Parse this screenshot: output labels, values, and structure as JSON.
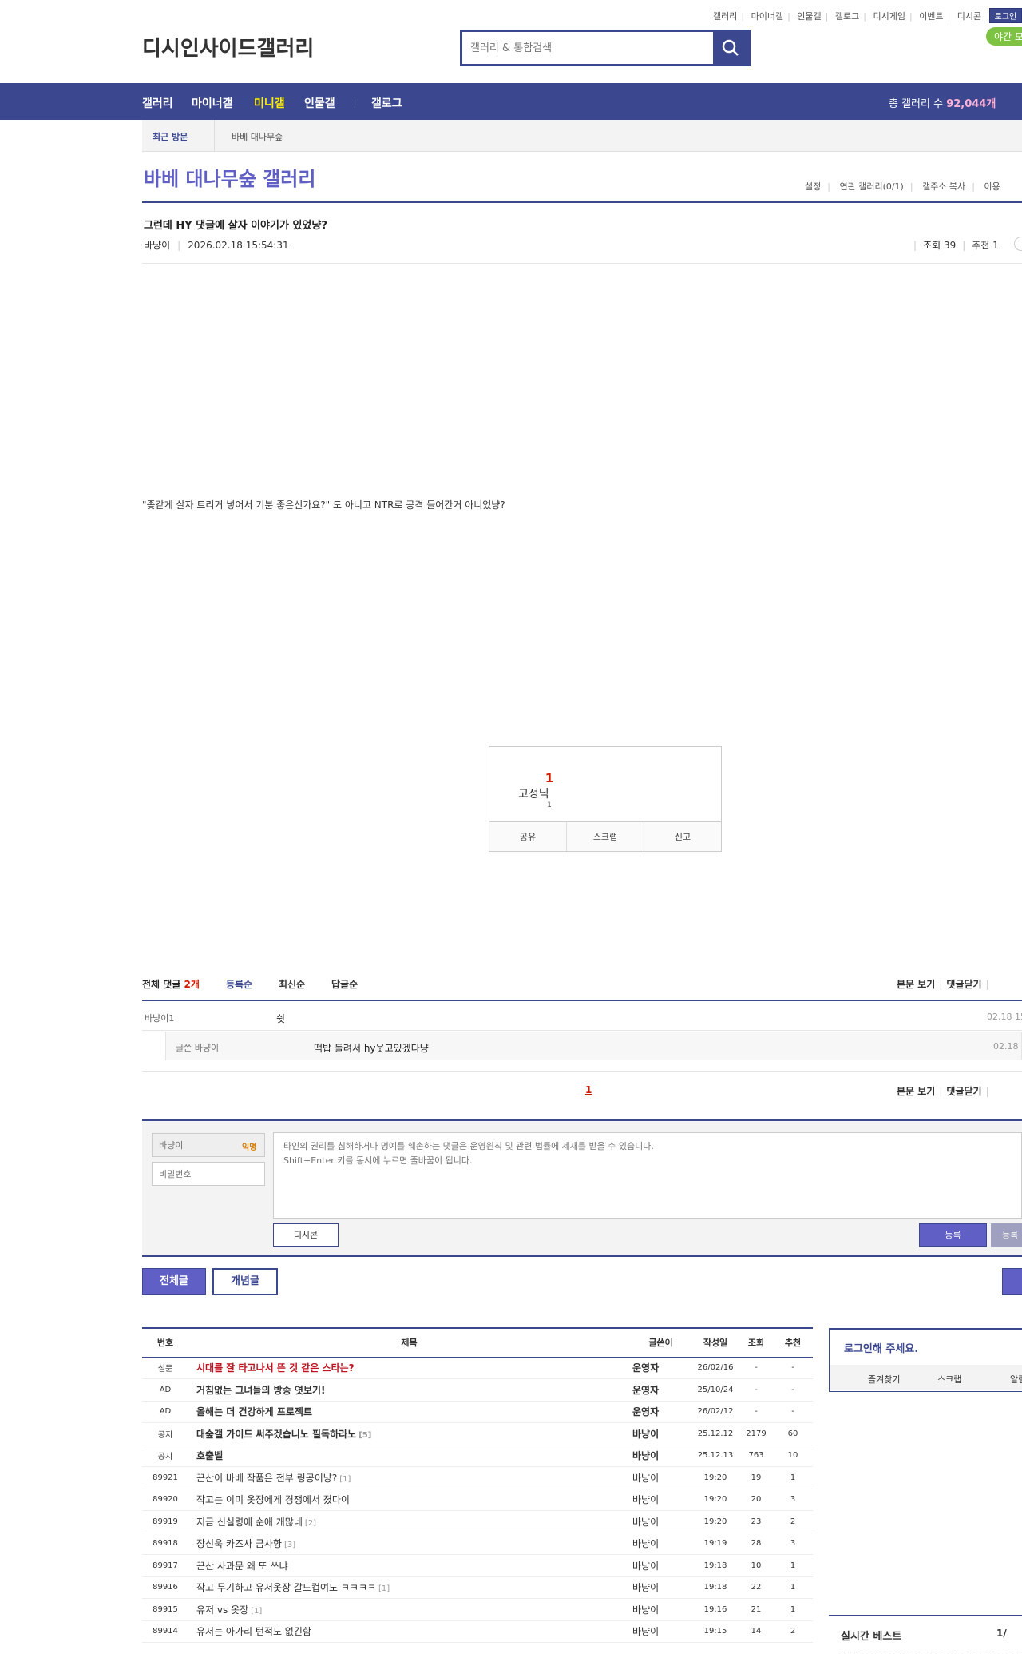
{
  "topbar": {
    "links": [
      "갤러리",
      "마이너갤",
      "인물갤",
      "갤로그",
      "디시게임",
      "이벤트",
      "디시콘"
    ],
    "login": "로그인"
  },
  "header": {
    "logo_alt": "디시인사이드갤러리",
    "search_placeholder": "갤러리 & 통합검색",
    "night_mode": "야간 모"
  },
  "gnb": {
    "items": [
      "갤러리",
      "마이너갤",
      "미니갤",
      "인물갤",
      "갤로그"
    ],
    "active_index": 2,
    "total_label": "총 갤러리 수",
    "total_count": "92,044개"
  },
  "recent": {
    "title": "최근 방문",
    "gallery": "바베 대나무숲"
  },
  "gallery": {
    "title": "바베 대나무숲 갤러리",
    "options": [
      "설정",
      "연관 갤러리(0/1)",
      "갤주소 복사",
      "이용"
    ]
  },
  "post": {
    "title": "그런데 HY 댓글에 살자 이야기가 있었냥?",
    "author": "바냥이",
    "date": "2026.02.18 15:54:31",
    "views": "조회 39",
    "recommends": "추천 1",
    "body": "\"좆같게 살자 트리거 넣어서 기분 좋은신가요?\" 도 아니고 NTR로 공격 들어간거 아니었냥?"
  },
  "recommend_box": {
    "count": "1",
    "fixed_alt": "고정닉",
    "fixed_count": "1",
    "buttons": [
      "공유",
      "스크랩",
      "신고"
    ]
  },
  "comments": {
    "total_label": "전체 댓글",
    "total_count": "2개",
    "sorts": [
      "등록순",
      "최신순",
      "답글순"
    ],
    "view_post": "본문 보기",
    "close": "댓글닫기",
    "items": [
      {
        "nick": "바냥이1",
        "text": "쉿",
        "date": "02.18 15"
      }
    ],
    "replies": [
      {
        "nick": "글쓴 바냥이",
        "text": "떡밥 돌려서 hy웃고있겠다냥",
        "date": "02.18 1"
      }
    ],
    "page": "1"
  },
  "write": {
    "nick_placeholder": "바냥이",
    "anon": "익명",
    "pw_placeholder": "비밀번호",
    "textarea_placeholder": "타인의 권리를 침해하거나 명예를 훼손하는 댓글은 운영원칙 및 관련 법률에 제재를 받을 수 있습니다.\nShift+Enter 키를 동시에 누르면 줄바꿈이 됩니다.",
    "dccon": "디시콘",
    "submit": "등록",
    "submit2": "등록"
  },
  "tabs": {
    "all": "전체글",
    "best": "개념글"
  },
  "board": {
    "headers": [
      "번호",
      "제목",
      "글쓴이",
      "작성일",
      "조회",
      "추천"
    ],
    "rows": [
      {
        "no": "설문",
        "title": "시대를 잘 타고나서 뜬 것 같은 스타는?",
        "replies": "",
        "writer": "운영자",
        "date": "26/02/16",
        "views": "-",
        "rec": "-",
        "type": "survey"
      },
      {
        "no": "AD",
        "title": "거침없는 그녀들의 방송 엿보기!",
        "replies": "",
        "writer": "운영자",
        "date": "25/10/24",
        "views": "-",
        "rec": "-",
        "type": "notice"
      },
      {
        "no": "AD",
        "title": "올해는 더 건강하게 프로젝트",
        "replies": "",
        "writer": "운영자",
        "date": "26/02/12",
        "views": "-",
        "rec": "-",
        "type": "notice"
      },
      {
        "no": "공지",
        "title": "대숲갤 가이드 써주겠습니노 필독하라노",
        "replies": "[5]",
        "writer": "바냥이",
        "date": "25.12.12",
        "views": "2179",
        "rec": "60",
        "type": "notice"
      },
      {
        "no": "공지",
        "title": "호출벨",
        "replies": "",
        "writer": "바냥이",
        "date": "25.12.13",
        "views": "763",
        "rec": "10",
        "type": "notice"
      },
      {
        "no": "89921",
        "title": "끈산이 바베 작품은 전부 링공이냥?",
        "replies": "[1]",
        "writer": "바냥이",
        "date": "19:20",
        "views": "19",
        "rec": "1",
        "type": "normal"
      },
      {
        "no": "89920",
        "title": "작고는 이미 옷장에게 경쟁에서 졌다이",
        "replies": "",
        "writer": "바냥이",
        "date": "19:20",
        "views": "20",
        "rec": "3",
        "type": "normal"
      },
      {
        "no": "89919",
        "title": "지금 신실령에 순애 개많네",
        "replies": "[2]",
        "writer": "바냥이",
        "date": "19:20",
        "views": "23",
        "rec": "2",
        "type": "normal"
      },
      {
        "no": "89918",
        "title": "장신욱 카즈사 금사향",
        "replies": "[3]",
        "writer": "바냥이",
        "date": "19:19",
        "views": "28",
        "rec": "3",
        "type": "normal"
      },
      {
        "no": "89917",
        "title": "끈산 사과문 왜 또 쓰냐",
        "replies": "",
        "writer": "바냥이",
        "date": "19:18",
        "views": "10",
        "rec": "1",
        "type": "normal"
      },
      {
        "no": "89916",
        "title": "작고 무기하고 유저옷장 갈드컵여노 ㅋㅋㅋㅋ",
        "replies": "[1]",
        "writer": "바냥이",
        "date": "19:18",
        "views": "22",
        "rec": "1",
        "type": "normal"
      },
      {
        "no": "89915",
        "title": "유저 vs 옷장",
        "replies": "[1]",
        "writer": "바냥이",
        "date": "19:16",
        "views": "21",
        "rec": "1",
        "type": "normal"
      },
      {
        "no": "89914",
        "title": "유저는 아가리 턴적도 없긴함",
        "replies": "",
        "writer": "바냥이",
        "date": "19:15",
        "views": "14",
        "rec": "2",
        "type": "normal"
      }
    ]
  },
  "side": {
    "login_title": "로그인해 주세요.",
    "login_buttons": [
      "즐겨찾기",
      "스크랩",
      "알림"
    ],
    "best_title": "실시간 베스트",
    "best_page": "1/"
  },
  "colors": {
    "brand": "#3b4890",
    "accent": "#5f5fc6",
    "red": "#d31900"
  }
}
